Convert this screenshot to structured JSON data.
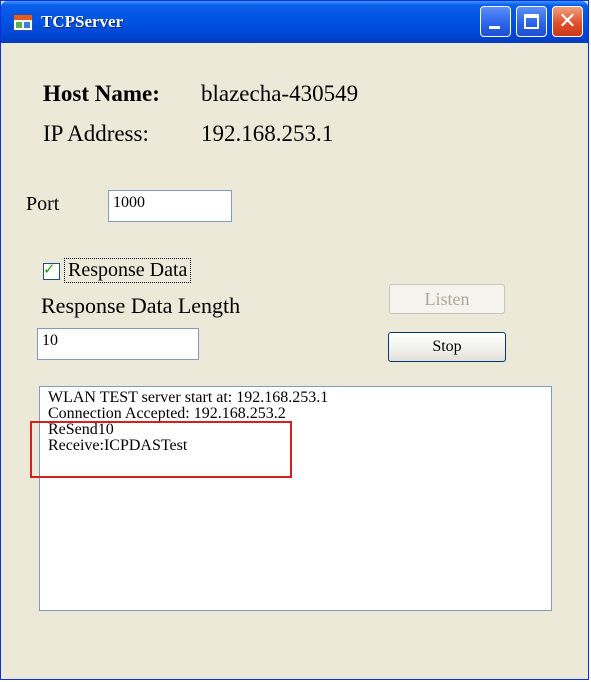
{
  "window": {
    "title": "TCPServer"
  },
  "host": {
    "label": "Host Name:",
    "value": "blazecha-430549"
  },
  "ip": {
    "label": "IP Address:",
    "value": "192.168.253.1"
  },
  "port": {
    "label": "Port",
    "value": "1000"
  },
  "response": {
    "checkbox_label": "Response Data",
    "checked": true,
    "length_label": "Response Data Length",
    "length_value": "10"
  },
  "buttons": {
    "listen": "Listen",
    "stop": "Stop"
  },
  "log": {
    "lines": [
      "WLAN TEST server start at: 192.168.253.1",
      "Connection Accepted: 192.168.253.2",
      "ReSend10",
      "Receive:ICPDASTest"
    ]
  },
  "colors": {
    "titlebar": "#0054e3",
    "window_bg": "#ece9d8",
    "highlight": "#d42020",
    "checkmark": "#21a121"
  },
  "icons": {
    "app": "app-icon",
    "minimize": "minimize-icon",
    "maximize": "maximize-icon",
    "close": "close-icon",
    "check": "checkmark-icon"
  }
}
